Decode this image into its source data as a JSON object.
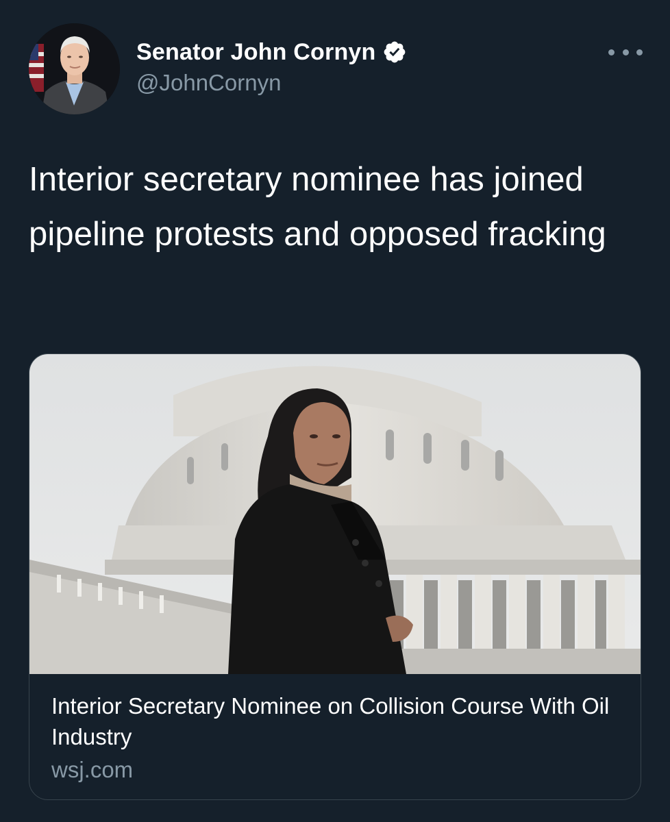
{
  "author": {
    "display_name": "Senator John Cornyn",
    "handle": "@JohnCornyn",
    "verified": true,
    "avatar_icon": "profile-photo"
  },
  "menu": {
    "icon": "more-options-icon"
  },
  "tweet": {
    "text": "Interior secretary nominee has joined pipeline protests and opposed fracking"
  },
  "link_card": {
    "title": "Interior Secretary Nominee on Collision Course With Oil Industry",
    "domain": "wsj.com",
    "image_icon": "article-photo-capitol"
  },
  "colors": {
    "background": "#15202b",
    "secondary_text": "#8899a6",
    "border": "#38444d",
    "verified_badge": "#ffffff"
  }
}
